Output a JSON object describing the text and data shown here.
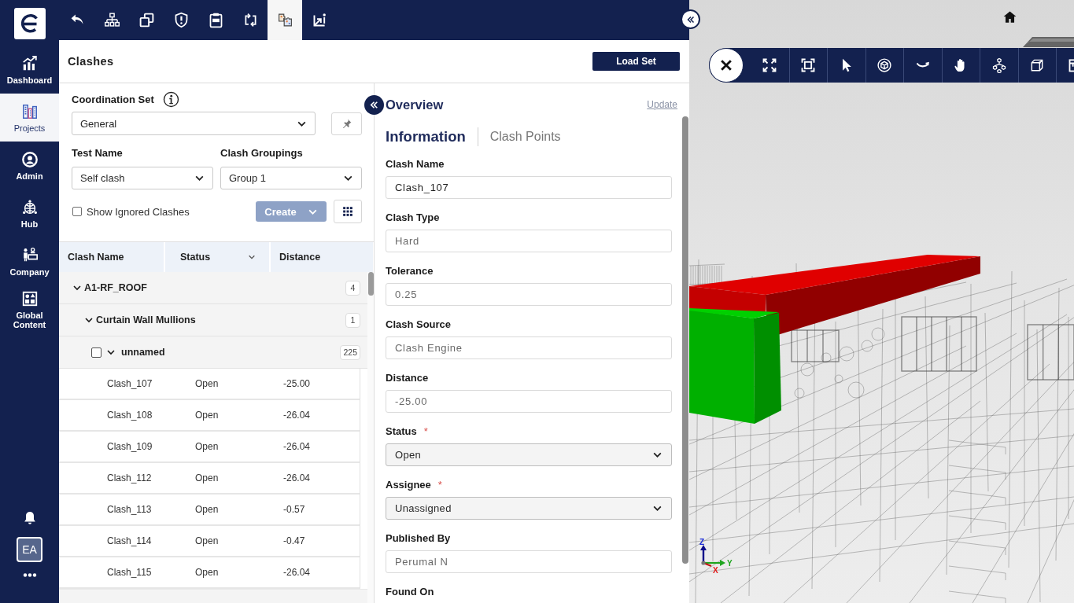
{
  "nav": {
    "items": [
      {
        "label": "Dashboard",
        "selected": false
      },
      {
        "label": "Projects",
        "selected": true
      },
      {
        "label": "Admin",
        "selected": false
      },
      {
        "label": "Hub",
        "selected": false
      },
      {
        "label": "Company",
        "selected": false
      },
      {
        "label": "Global Content",
        "selected": false
      }
    ],
    "avatar": "EA"
  },
  "toolbar": {
    "tools": [
      {
        "selected": false
      },
      {
        "selected": false
      },
      {
        "selected": false
      },
      {
        "selected": false
      },
      {
        "selected": false
      },
      {
        "selected": false
      },
      {
        "selected": true
      },
      {
        "selected": false
      }
    ]
  },
  "header": {
    "title": "Clashes",
    "action": "Load Set"
  },
  "filters": {
    "coordination": {
      "label": "Coordination Set",
      "value": "General"
    },
    "test": {
      "label": "Test Name",
      "value": "Self clash"
    },
    "grouping": {
      "label": "Clash Groupings",
      "value": "Group 1"
    },
    "show_ignored": {
      "label": "Show Ignored Clashes",
      "checked": false
    },
    "create": {
      "label": "Create",
      "disabled": true
    }
  },
  "table": {
    "columns": [
      {
        "label": "Clash Name",
        "kind": "plain"
      },
      {
        "label": "Status",
        "kind": "dropdown"
      },
      {
        "label": "Distance",
        "kind": "plain"
      }
    ],
    "groups": [
      {
        "name": "A1-RF_ROOF",
        "count": "4",
        "expanded": true,
        "children": [
          {
            "name": "Curtain Wall Mullions",
            "count": "1",
            "expanded": true,
            "children": [
              {
                "name": "unnamed",
                "count": "225",
                "expanded": true,
                "checked": false,
                "rows": [
                  {
                    "name": "Clash_107",
                    "status": "Open",
                    "distance": "-25.00"
                  },
                  {
                    "name": "Clash_108",
                    "status": "Open",
                    "distance": "-26.04"
                  },
                  {
                    "name": "Clash_109",
                    "status": "Open",
                    "distance": "-26.04"
                  },
                  {
                    "name": "Clash_112",
                    "status": "Open",
                    "distance": "-26.04"
                  },
                  {
                    "name": "Clash_113",
                    "status": "Open",
                    "distance": "-0.57"
                  },
                  {
                    "name": "Clash_114",
                    "status": "Open",
                    "distance": "-0.47"
                  },
                  {
                    "name": "Clash_115",
                    "status": "Open",
                    "distance": "-26.04"
                  }
                ]
              }
            ]
          }
        ]
      }
    ]
  },
  "overview": {
    "title": "Overview",
    "update_link": "Update",
    "tabs": [
      {
        "label": "Information",
        "selected": true
      },
      {
        "label": "Clash Points",
        "selected": false
      }
    ],
    "fields": [
      {
        "label": "Clash Name",
        "value": "Clash_107",
        "kind": "text",
        "disabled": false
      },
      {
        "label": "Clash Type",
        "value": "Hard",
        "kind": "text",
        "disabled": true
      },
      {
        "label": "Tolerance",
        "value": "0.25",
        "kind": "text",
        "disabled": true
      },
      {
        "label": "Clash Source",
        "value": "Clash Engine",
        "kind": "text",
        "disabled": true
      },
      {
        "label": "Distance",
        "value": "-25.00",
        "kind": "text",
        "disabled": true
      },
      {
        "label": "Status",
        "required_mark": "*",
        "value": "Open",
        "kind": "select",
        "disabled": false
      },
      {
        "label": "Assignee",
        "required_mark": "*",
        "value": "Unassigned",
        "kind": "select",
        "disabled": false
      },
      {
        "label": "Published By",
        "value": "Perumal N",
        "kind": "text",
        "disabled": true
      },
      {
        "label": "Found On"
      }
    ]
  },
  "viewer": {
    "axis_labels": [
      "Z",
      "Y",
      "X"
    ]
  }
}
